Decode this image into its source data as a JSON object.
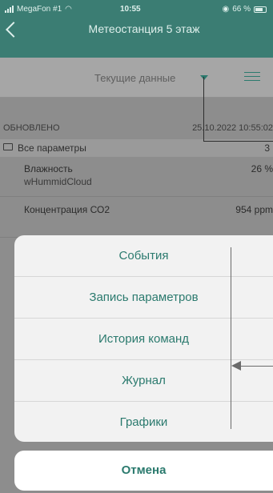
{
  "status_bar": {
    "carrier": "MegaFon #1",
    "time": "10:55",
    "battery": "66 %"
  },
  "nav": {
    "title": "Метеостанция 5 этаж"
  },
  "segment": {
    "label": "Текущие данные"
  },
  "updated": {
    "label": "ОБНОВЛЕНО",
    "value": "25.10.2022 10:55:02"
  },
  "all_params": {
    "label": "Все параметры",
    "count": "3"
  },
  "rows": [
    {
      "name": "Влажность",
      "sub": "wHummidCloud",
      "value": "26 %"
    },
    {
      "name": "Концентрация СО2",
      "sub": "",
      "value": "954 ppm"
    }
  ],
  "action_sheet": {
    "items": [
      "События",
      "Запись параметров",
      "История команд",
      "Журнал",
      "Графики"
    ],
    "cancel": "Отмена"
  },
  "colors": {
    "header": "#3b7d73",
    "accent": "#2b7a6e"
  }
}
